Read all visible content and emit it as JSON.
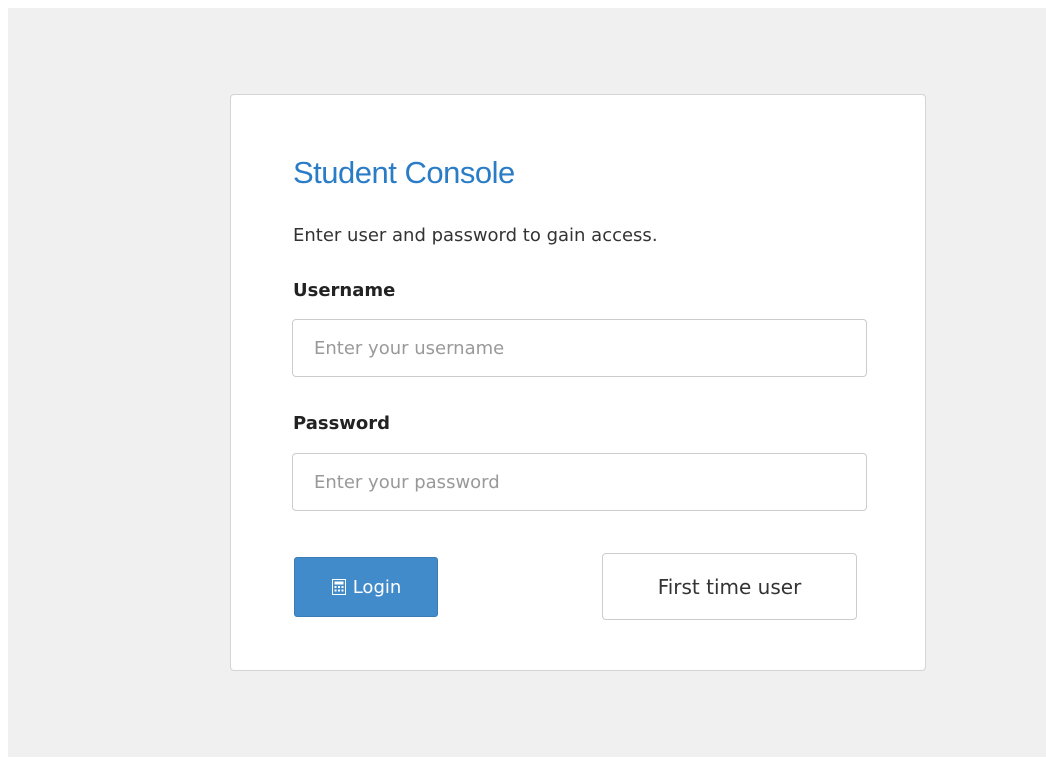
{
  "login": {
    "title": "Student Console",
    "subtitle": "Enter user and password to gain access.",
    "username": {
      "label": "Username",
      "value": "",
      "placeholder": "Enter your username"
    },
    "password": {
      "label": "Password",
      "value": "",
      "placeholder": "Enter your password"
    },
    "login_button": {
      "label": "Login",
      "icon": "keypad-icon"
    },
    "first_time_button": {
      "label": "First time user"
    }
  },
  "colors": {
    "page_background": "#f0f0f0",
    "card_background": "#ffffff",
    "title": "#2a7cc7",
    "primary_button": "#428bca"
  }
}
